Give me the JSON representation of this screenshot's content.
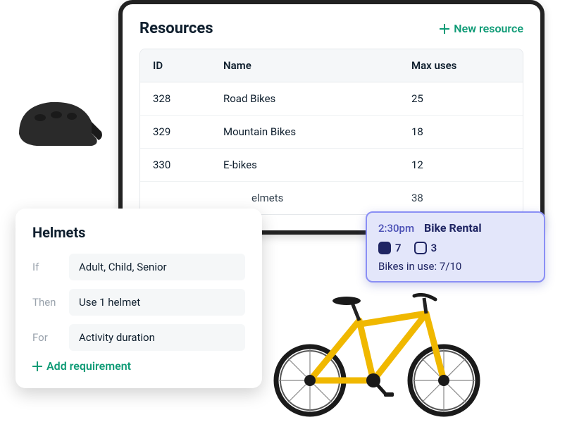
{
  "resources": {
    "title": "Resources",
    "new_btn": "New resource",
    "cols": {
      "id": "ID",
      "name": "Name",
      "max": "Max uses"
    },
    "rows": [
      {
        "id": "328",
        "name": "Road Bikes",
        "max": "25"
      },
      {
        "id": "329",
        "name": "Mountain Bikes",
        "max": "18"
      },
      {
        "id": "330",
        "name": "E-bikes",
        "max": "12"
      },
      {
        "id": " ",
        "name": "elmets",
        "max": "38"
      }
    ]
  },
  "helmets": {
    "title": "Helmets",
    "rules": {
      "if_label": "If",
      "if_value": "Adult, Child, Senior",
      "then_label": "Then",
      "then_value": "Use 1 helmet",
      "for_label": "For",
      "for_value": "Activity duration"
    },
    "add_btn": "Add requirement"
  },
  "booking": {
    "time": "2:30pm",
    "title": "Bike Rental",
    "count1": "7",
    "count2": "3",
    "status": "Bikes in use: 7/10"
  }
}
